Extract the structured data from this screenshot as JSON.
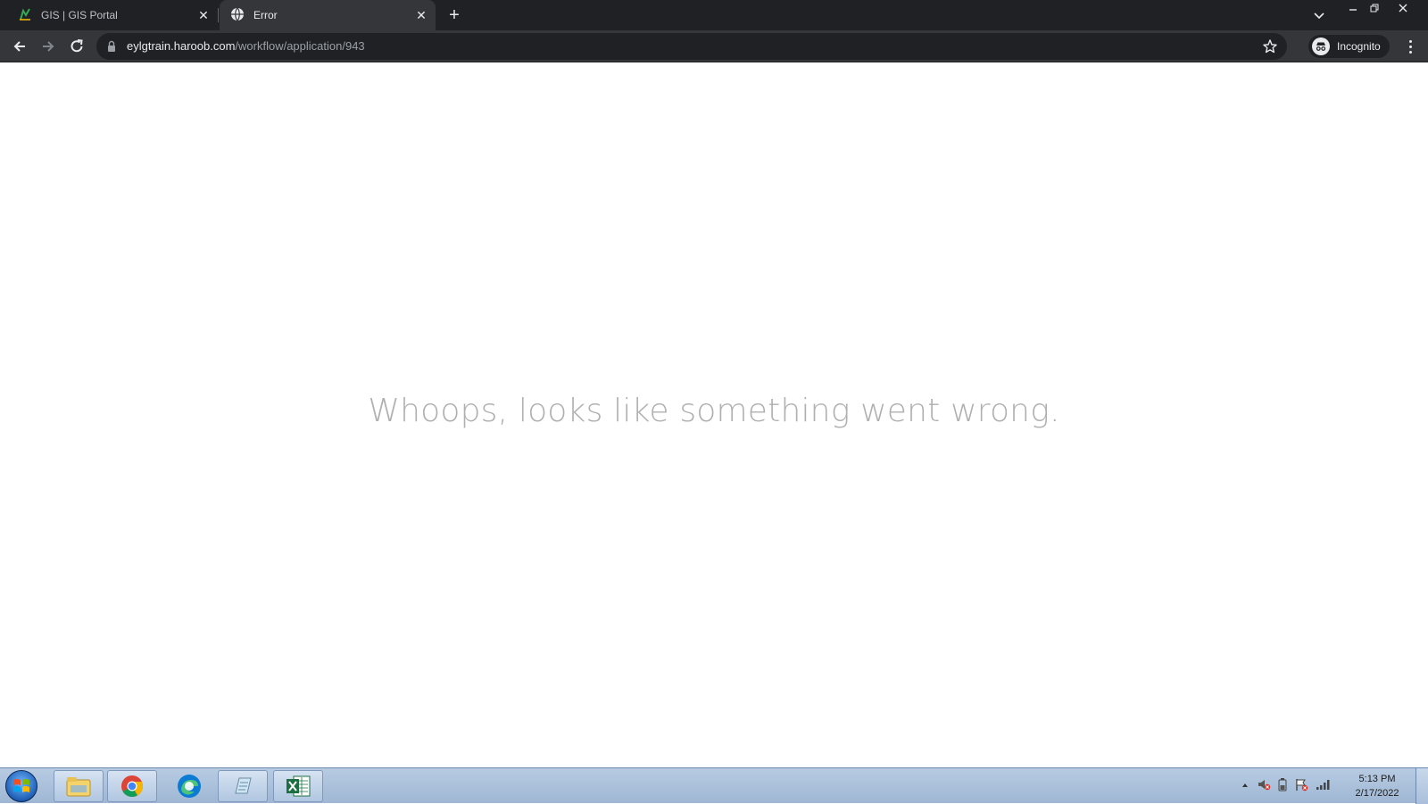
{
  "browser": {
    "tabs": [
      {
        "title": "GIS | GIS Portal",
        "active": false
      },
      {
        "title": "Error",
        "active": true
      }
    ],
    "url_host": "eylgtrain.haroob.com",
    "url_path": "/workflow/application/943",
    "profile_label": "Incognito",
    "icons": {
      "tab1_favicon": "gis-leaf-icon",
      "tab2_favicon": "globe-icon",
      "new_tab": "plus-icon",
      "tab_search": "chevron-down-icon",
      "back": "arrow-left-icon",
      "forward": "arrow-right-icon",
      "reload": "reload-icon",
      "lock": "lock-icon",
      "bookmark": "star-icon",
      "incognito": "incognito-icon",
      "menu": "kebab-menu-icon"
    }
  },
  "page": {
    "message": "Whoops, looks like something went wrong."
  },
  "taskbar": {
    "apps": [
      "file-explorer",
      "chrome",
      "edge",
      "notepad",
      "excel"
    ],
    "clock_time": "5:13 PM",
    "clock_date": "2/17/2022"
  },
  "colors": {
    "tab_strip": "#202124",
    "toolbar": "#35363a",
    "message_text": "#b0b0b0",
    "taskbar": "#a9bfdb"
  }
}
